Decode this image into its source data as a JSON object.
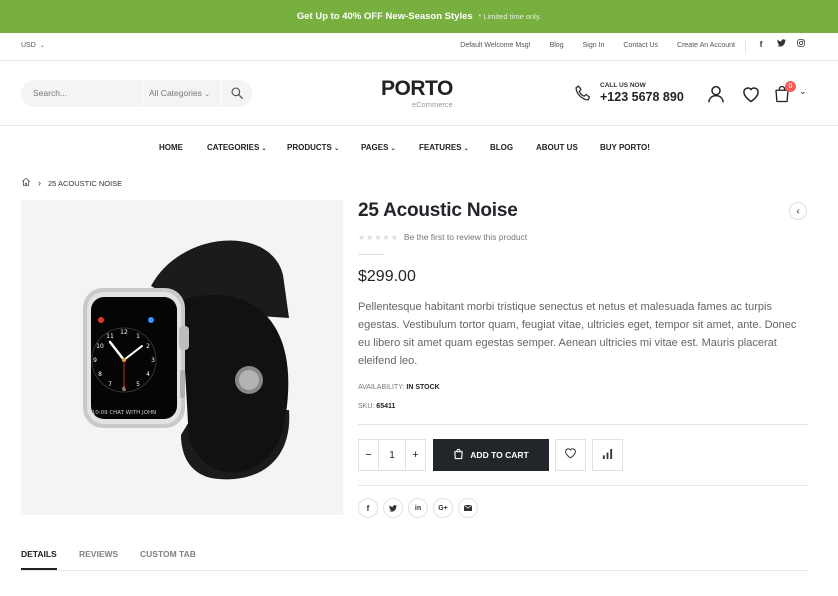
{
  "promo": {
    "prefix": "Get Up to",
    "bold": "40% OFF",
    "suffix": "New-Season Styles",
    "note": "* Limited time only."
  },
  "topbar": {
    "currency": "USD",
    "links": [
      "Default Welcome Msg!",
      "Blog",
      "Sign In",
      "Contact Us",
      "Create An Account"
    ],
    "socials": [
      "facebook-icon",
      "twitter-icon",
      "instagram-icon"
    ]
  },
  "header": {
    "search_placeholder": "Search...",
    "category_select": "All Categories",
    "logo_word": "PORTO",
    "logo_sub": "eCommerce",
    "phone_label": "CALL US NOW",
    "phone_number": "+123 5678 890",
    "cart_count": "0"
  },
  "nav": [
    "HOME",
    "CATEGORIES",
    "PRODUCTS",
    "PAGES",
    "FEATURES",
    "BLOG",
    "ABOUT US",
    "BUY PORTO!"
  ],
  "breadcrumb": {
    "current": "25 ACOUSTIC NOISE"
  },
  "product": {
    "title": "25 Acoustic Noise",
    "review_text": "Be the first to review this product",
    "price": "$299.00",
    "description": "Pellentesque habitant morbi tristique senectus et netus et malesuada fames ac turpis egestas. Vestibulum tortor quam, feugiat vitae, ultricies eget, tempor sit amet, ante. Donec eu libero sit amet quam egestas semper. Aenean ultricies mi vitae est. Mauris placerat eleifend leo.",
    "availability_label": "AVAILABILITY:",
    "availability_value": "IN STOCK",
    "sku_label": "SKU:",
    "sku_value": "65411",
    "quantity": "1",
    "add_to_cart": "ADD TO CART",
    "watch_text": "10:09 CHAT WITH JOHN"
  },
  "tabs": [
    "DETAILS",
    "REVIEWS",
    "CUSTOM TAB"
  ],
  "colors": {
    "promo_green": "#77b03e",
    "dark": "#222529",
    "badge": "#ff5b5b"
  }
}
